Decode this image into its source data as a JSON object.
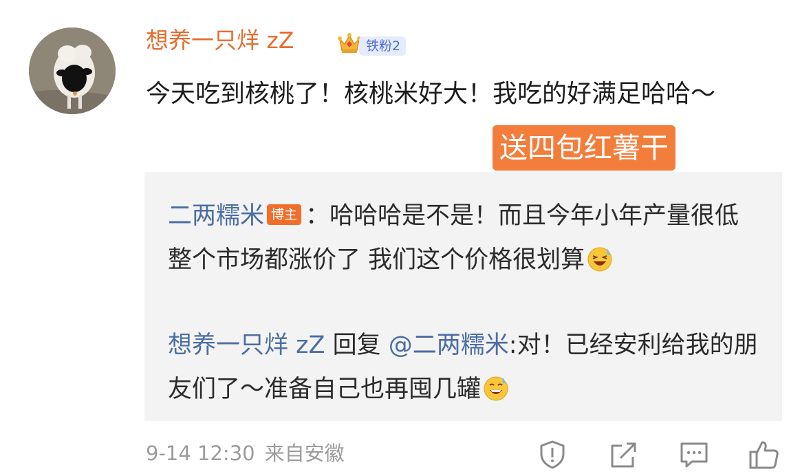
{
  "comment": {
    "author": "想养一只烊 zZ",
    "fan_badge": "铁粉2",
    "text": "今天吃到核桃了！核桃米好大！我吃的好满足哈哈～",
    "gift_tag": "送四包红薯干",
    "time": "9-14 12:30",
    "source": "来自安徽"
  },
  "replies": [
    {
      "author": "二两糯米",
      "badge": "博主",
      "separator": "：",
      "text": "哈哈哈是不是！而且今年小年产量很低 整个市场都涨价了 我们这个价格很划算"
    },
    {
      "author": "想养一只烊 zZ",
      "reply_word": " 回复 ",
      "mention": "@二两糯米",
      "separator": ":",
      "text": "对！已经安利给我的朋友们了～准备自己也再囤几罐"
    }
  ],
  "icons": {
    "avatar": "sheep-photo",
    "crown": "crown-icon",
    "emoji_1": "laughing-sweat-emoji",
    "emoji_2": "grinning-sweat-emoji",
    "report": "shield-report-icon",
    "share": "share-icon",
    "comment": "comment-icon",
    "like": "thumbs-up-icon"
  },
  "colors": {
    "username": "#e96c2c",
    "reply_name": "#4a6da2",
    "gift_tag": "#f37e3c",
    "host_badge": "#f06e2a",
    "fan_badge_bg": "#e6ecff"
  }
}
